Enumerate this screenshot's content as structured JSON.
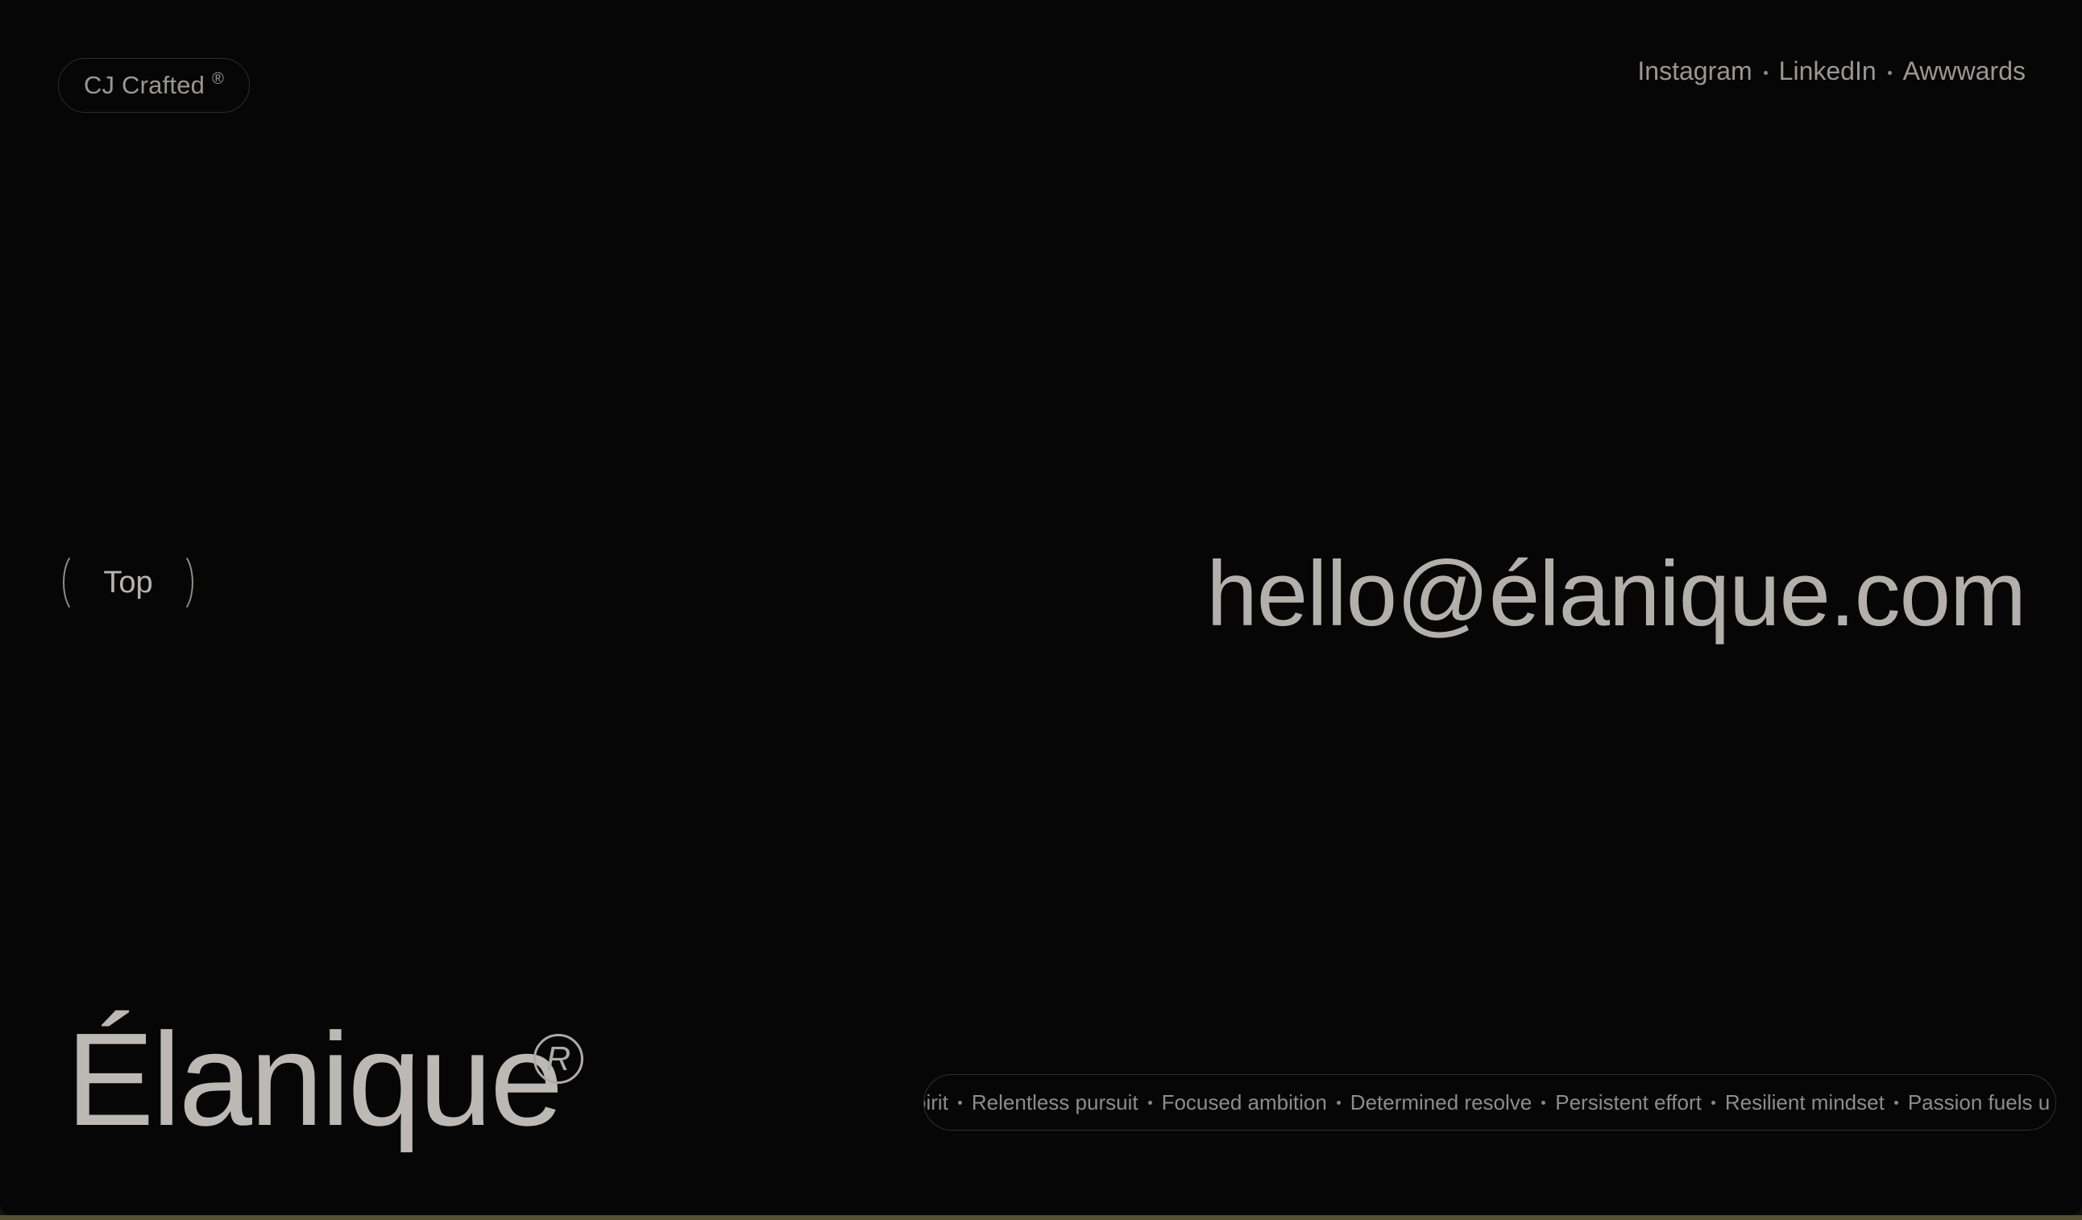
{
  "brand": {
    "name": "CJ Crafted",
    "mark": "®"
  },
  "social": {
    "links": [
      "Instagram",
      "LinkedIn",
      "Awwwards"
    ]
  },
  "top_button": {
    "label": "Top"
  },
  "contact": {
    "email": "hello@élanique.com"
  },
  "footer": {
    "wordmark": "Élanique",
    "registered": "R"
  },
  "marquee": {
    "items": [
      "pirit",
      "Relentless pursuit",
      "Focused ambition",
      "Determined resolve",
      "Persistent effort",
      "Resilient mindset",
      "Passion fuels u"
    ]
  },
  "colors": {
    "background": "#060606",
    "text": "#a9a6a2",
    "border": "#2f2f2f"
  }
}
